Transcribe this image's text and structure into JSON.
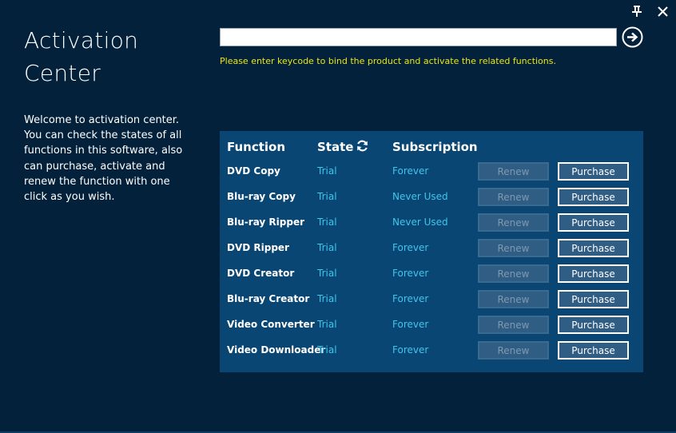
{
  "window": {
    "title_line1": "Activation",
    "title_line2": "Center",
    "welcome": "Welcome to activation center. You can check the states of all functions in this software, also can purchase, activate and renew the function with one click as you wish."
  },
  "titlebar": {
    "icons": [
      "pin-icon",
      "close-icon"
    ]
  },
  "keycode": {
    "value": "",
    "placeholder": "",
    "hint": "Please enter keycode to bind the product and activate the related functions."
  },
  "table": {
    "headers": {
      "function": "Function",
      "state": "State",
      "subscription": "Subscription"
    },
    "renew_label": "Renew",
    "purchase_label": "Purchase",
    "rows": [
      {
        "function": "DVD Copy",
        "state": "Trial",
        "subscription": "Forever"
      },
      {
        "function": "Blu-ray Copy",
        "state": "Trial",
        "subscription": "Never Used"
      },
      {
        "function": "Blu-ray Ripper",
        "state": "Trial",
        "subscription": "Never Used"
      },
      {
        "function": "DVD Ripper",
        "state": "Trial",
        "subscription": "Forever"
      },
      {
        "function": "DVD Creator",
        "state": "Trial",
        "subscription": "Forever"
      },
      {
        "function": "Blu-ray Creator",
        "state": "Trial",
        "subscription": "Forever"
      },
      {
        "function": "Video Converter",
        "state": "Trial",
        "subscription": "Forever"
      },
      {
        "function": "Video Downloader",
        "state": "Trial",
        "subscription": "Forever"
      }
    ]
  },
  "colors": {
    "background": "#03213a",
    "panel": "#0a4673",
    "accent_text": "#3fc6ea",
    "hint_text": "#e8e619",
    "button_fill": "#2f5d83"
  }
}
